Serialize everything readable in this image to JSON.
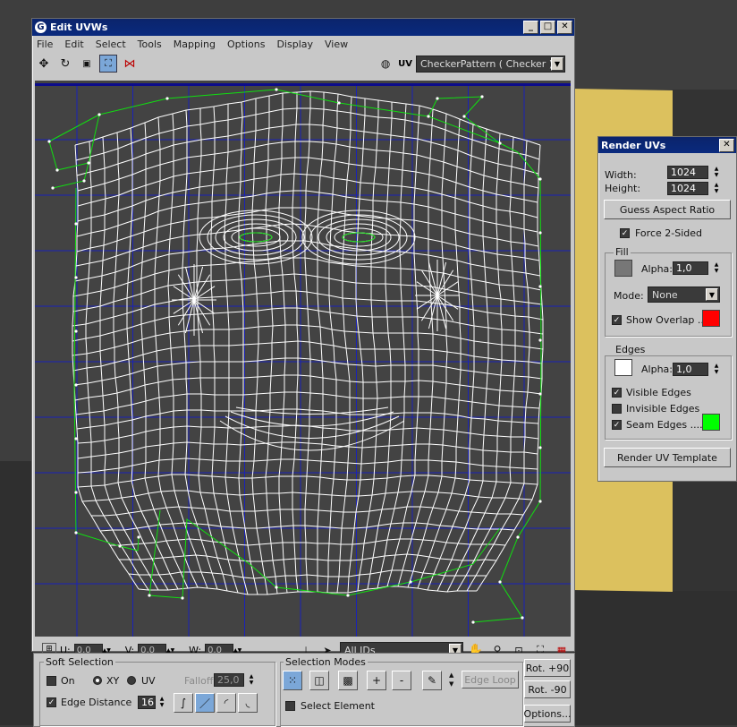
{
  "uvw_window": {
    "title": "Edit UVWs",
    "menu": [
      "File",
      "Edit",
      "Select",
      "Tools",
      "Mapping",
      "Options",
      "Display",
      "View"
    ],
    "uv_label": "UV",
    "texture_select": "CheckerPattern  ( Checker )",
    "status": {
      "u_label": "U:",
      "u_value": "0,0",
      "v_label": "V:",
      "v_value": "0,0",
      "w_label": "W:",
      "w_value": "0,0",
      "id_select": "All IDs"
    }
  },
  "render_uvs": {
    "title": "Render UVs",
    "width_label": "Width:",
    "width_value": "1024",
    "height_label": "Height:",
    "height_value": "1024",
    "guess_aspect": "Guess Aspect Ratio",
    "force_2sided": "Force 2-Sided",
    "fill_group": "Fill",
    "fill_alpha_label": "Alpha:",
    "fill_alpha_value": "1,0",
    "mode_label": "Mode:",
    "mode_value": "None",
    "show_overlap": "Show Overlap ...",
    "edges_group": "Edges",
    "edges_alpha_label": "Alpha:",
    "edges_alpha_value": "1,0",
    "visible_edges": "Visible Edges",
    "invisible_edges": "Invisible Edges",
    "seam_edges": "Seam Edges ....",
    "render_template": "Render UV Template",
    "colors": {
      "fill": "#777777",
      "overlap": "#ff0000",
      "edge": "#ffffff",
      "seam": "#00ff00"
    }
  },
  "bottom_panel": {
    "soft_selection": "Soft Selection",
    "on_label": "On",
    "xy_label": "XY",
    "uv_label": "UV",
    "falloff_label": "Falloff:",
    "falloff_value": "25,0",
    "edge_distance": "Edge Distance",
    "edge_distance_value": "16",
    "selection_modes": "Selection Modes",
    "plus_label": "+",
    "minus_label": "-",
    "edge_loop": "Edge Loop",
    "select_element": "Select Element",
    "rot_plus": "Rot. +90",
    "rot_minus": "Rot. -90",
    "options": "Options..."
  }
}
